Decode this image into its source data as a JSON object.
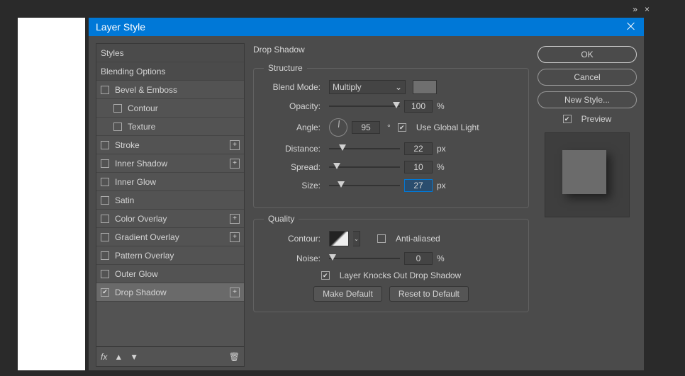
{
  "window": {
    "title": "Layer Style"
  },
  "topbar": {
    "collapse": "»",
    "close": "×"
  },
  "left": {
    "styles_header": "Styles",
    "blending_options": "Blending Options",
    "bevel_emboss": "Bevel & Emboss",
    "contour": "Contour",
    "texture": "Texture",
    "stroke": "Stroke",
    "inner_shadow": "Inner Shadow",
    "inner_glow": "Inner Glow",
    "satin": "Satin",
    "color_overlay": "Color Overlay",
    "gradient_overlay": "Gradient Overlay",
    "pattern_overlay": "Pattern Overlay",
    "outer_glow": "Outer Glow",
    "drop_shadow": "Drop Shadow",
    "fx_label": "fx",
    "plus": "+"
  },
  "mid": {
    "title": "Drop Shadow",
    "structure_legend": "Structure",
    "blend_mode_label": "Blend Mode:",
    "blend_mode_value": "Multiply",
    "opacity_label": "Opacity:",
    "opacity_value": "100",
    "percent": "%",
    "angle_label": "Angle:",
    "angle_value": "95",
    "degree": "°",
    "use_global_light": "Use Global Light",
    "distance_label": "Distance:",
    "distance_value": "22",
    "px": "px",
    "spread_label": "Spread:",
    "spread_value": "10",
    "size_label": "Size:",
    "size_value": "27",
    "quality_legend": "Quality",
    "contour_label": "Contour:",
    "anti_aliased": "Anti-aliased",
    "noise_label": "Noise:",
    "noise_value": "0",
    "knockout": "Layer Knocks Out Drop Shadow",
    "make_default": "Make Default",
    "reset_default": "Reset to Default",
    "check": "✔",
    "caret": "⌄"
  },
  "right": {
    "ok": "OK",
    "cancel": "Cancel",
    "new_style": "New Style...",
    "preview": "Preview"
  }
}
